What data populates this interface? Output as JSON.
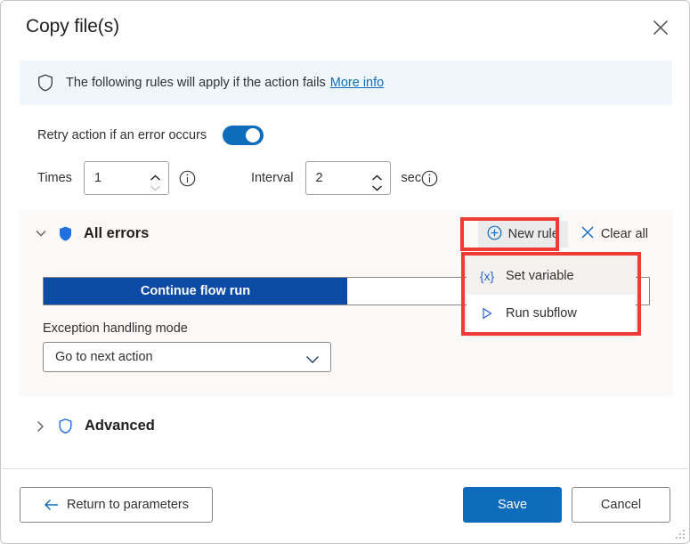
{
  "dialog": {
    "title": "Copy file(s)",
    "close_icon": "close-icon"
  },
  "banner": {
    "icon": "shield-outline-icon",
    "text": "The following rules will apply if the action fails",
    "link": "More info"
  },
  "retry": {
    "label": "Retry action if an error occurs",
    "toggle_on": true,
    "times_label": "Times",
    "times_value": "1",
    "times_info_icon": "info-circle-icon",
    "interval_label": "Interval",
    "interval_value": "2",
    "interval_unit": "sec",
    "interval_info_icon": "info-circle-icon"
  },
  "all_errors": {
    "expand_icon": "chevron-down-icon",
    "shield_icon": "shield-filled-icon",
    "title": "All errors",
    "new_rule_label": "New rule",
    "new_rule_icon": "plus-circle-icon",
    "clear_all_label": "Clear all",
    "clear_all_icon": "close-x-icon",
    "segmented": {
      "selected_label": "Continue flow run",
      "unselected_label": ""
    },
    "exception_mode_label": "Exception handling mode",
    "exception_mode_value": "Go to next action",
    "exception_mode_chevron": "chevron-down-icon"
  },
  "new_rule_menu": {
    "items": [
      {
        "label": "Set variable",
        "icon": "braces-x-icon",
        "icon_glyph": "{x}",
        "hovered": true
      },
      {
        "label": "Run subflow",
        "icon": "play-triangle-icon",
        "icon_glyph": "▷",
        "hovered": false
      }
    ]
  },
  "advanced": {
    "expand_icon": "chevron-right-icon",
    "shield_icon": "shield-outline-icon",
    "title": "Advanced"
  },
  "footer": {
    "return_label": "Return to parameters",
    "return_icon": "arrow-left-icon",
    "save_label": "Save",
    "cancel_label": "Cancel"
  },
  "colors": {
    "accent_blue": "#0f6cbd",
    "segment_blue": "#0b4ba6",
    "banner_bg": "#eff6fc",
    "card_bg": "#faf9f8",
    "annotation_red": "#ef3b34",
    "link_blue": "#0f6cbd"
  }
}
